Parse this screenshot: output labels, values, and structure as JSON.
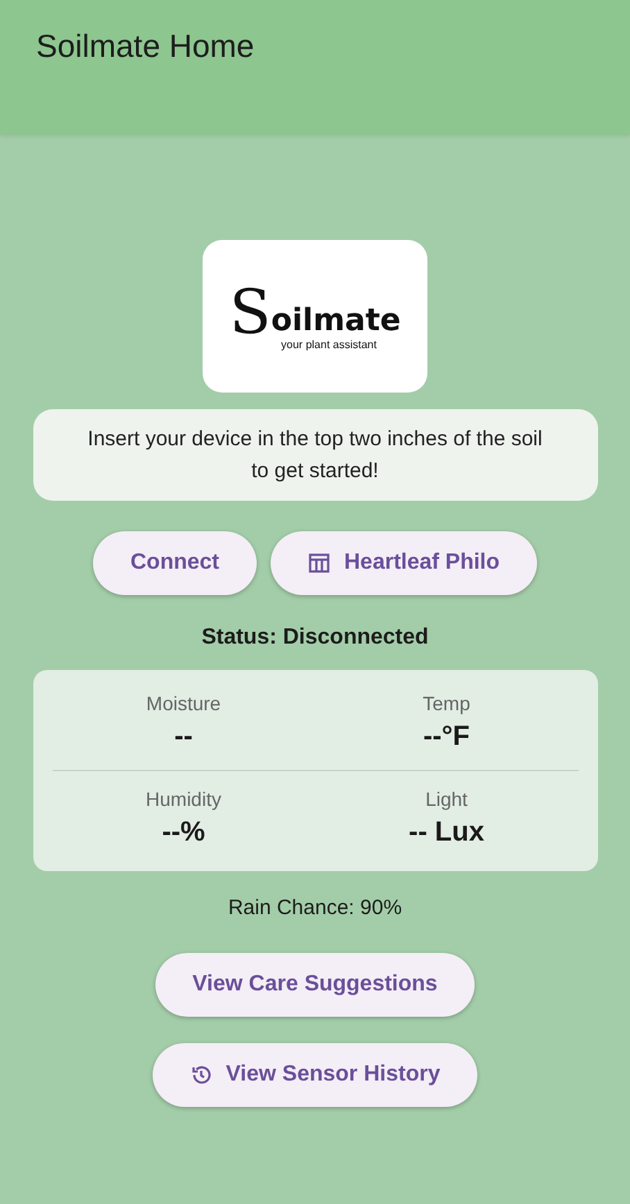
{
  "app_bar": {
    "title": "Soilmate Home"
  },
  "logo": {
    "name": "oilmate",
    "initial": "S",
    "tagline": "your plant assistant"
  },
  "intro": "Insert your device in the top two inches of the soil to get started!",
  "actions": [
    {
      "label": "Connect",
      "kind": "plain"
    },
    {
      "label": "Heartleaf Philo",
      "kind": "plant"
    }
  ],
  "status": "Status: Disconnected",
  "readings": [
    {
      "label": "Moisture",
      "value": "--"
    },
    {
      "label": "Temp",
      "value": "--°F"
    },
    {
      "label": "Humidity",
      "value": "--%"
    },
    {
      "label": "Light",
      "value": "-- Lux"
    }
  ],
  "rain": "Rain Chance: 90%",
  "links": [
    {
      "label": "View Care Suggestions",
      "kind": "plain"
    },
    {
      "label": "View Sensor History",
      "kind": "history"
    }
  ]
}
